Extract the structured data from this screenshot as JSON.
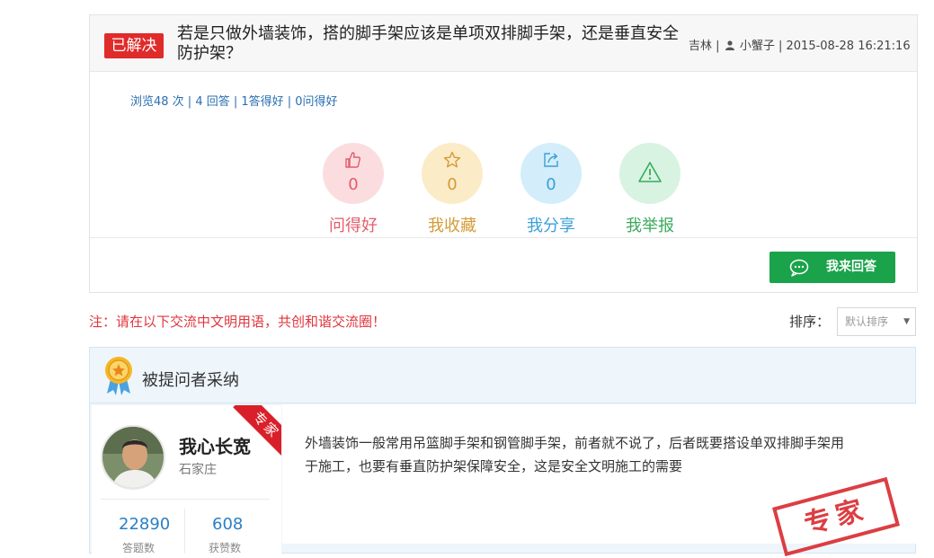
{
  "question": {
    "status_badge": "已解决",
    "title": "若是只做外墙装饰，搭的脚手架应该是单项双排脚手架，还是垂直安全防护架？",
    "region": "吉林",
    "separator": "|",
    "asker": "小蟹子",
    "datetime": "2015-08-28 16:21:16",
    "stats": "浏览48 次 | 4 回答 | 1答得好 | 0问得好"
  },
  "actions": {
    "like": {
      "count": "0",
      "label": "问得好",
      "icon": "thumbs-up-icon"
    },
    "favorite": {
      "count": "0",
      "label": "我收藏",
      "icon": "star-icon"
    },
    "share": {
      "count": "0",
      "label": "我分享",
      "icon": "share-icon"
    },
    "report": {
      "label": "我举报",
      "icon": "warning-icon"
    }
  },
  "answer_button": {
    "label": "我来回答",
    "icon": "chat-bubble-icon"
  },
  "notice": "注：请在以下交流中文明用语，共创和谐交流圈！",
  "sort": {
    "label": "排序：",
    "selected": "默认排序"
  },
  "adopted": {
    "title": "被提问者采纳",
    "expert": {
      "name": "我心长宽",
      "city": "石家庄",
      "ribbon": "专家",
      "stat1_value": "22890",
      "stat1_label": "答题数",
      "stat2_value": "608",
      "stat2_label": "获赞数"
    },
    "answer_text": "外墙装饰一般常用吊篮脚手架和钢管脚手架，前者就不说了，后者既要搭设单双排脚手架用于施工，也要有垂直防护架保障安全，这是安全文明施工的需要",
    "stamp": "专家"
  },
  "colors": {
    "badge_red": "#e02b2b",
    "link_blue": "#2a6fb0",
    "answer_green": "#1aa34a",
    "notice_red": "#e0363d"
  }
}
